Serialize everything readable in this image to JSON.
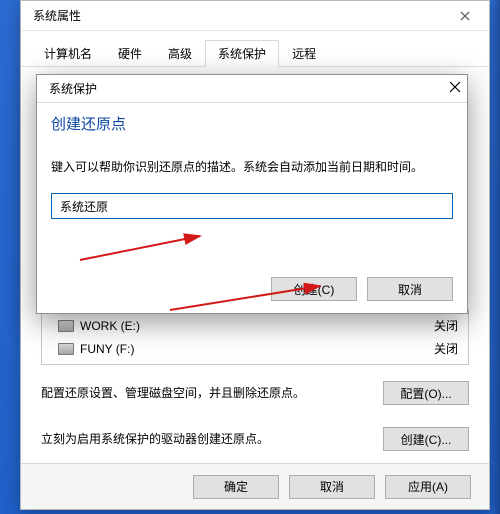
{
  "back": {
    "title": "系统属性",
    "tabs": [
      "计算机名",
      "硬件",
      "高级",
      "系统保护",
      "远程"
    ],
    "activeTab": "系统保护",
    "drives": [
      {
        "name": "WORK (E:)",
        "status": "关闭"
      },
      {
        "name": "FUNY (F:)",
        "status": "关闭"
      }
    ],
    "configText": "配置还原设置、管理磁盘空间，并且删除还原点。",
    "configBtn": "配置(O)...",
    "createText": "立刻为启用系统保护的驱动器创建还原点。",
    "createBtn": "创建(C)...",
    "ok": "确定",
    "cancel": "取消",
    "apply": "应用(A)"
  },
  "front": {
    "title": "系统保护",
    "heading": "创建还原点",
    "desc": "键入可以帮助你识别还原点的描述。系统会自动添加当前日期和时间。",
    "inputValue": "系统还原",
    "create": "创建(C)",
    "cancel": "取消"
  }
}
